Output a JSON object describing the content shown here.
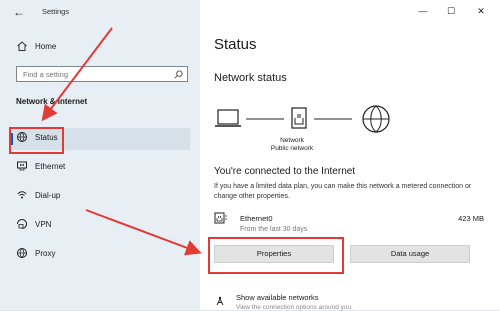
{
  "window": {
    "app_title": "Settings",
    "controls": {
      "minimize": "—",
      "maximize": "☐",
      "close": "✕"
    }
  },
  "nav": {
    "back_glyph": "←",
    "home_label": "Home",
    "search": {
      "placeholder": "Find a setting"
    },
    "section_heading": "Network & Internet",
    "items": [
      {
        "label": "Status",
        "icon": "globe-status-icon",
        "selected": true
      },
      {
        "label": "Ethernet",
        "icon": "ethernet-icon",
        "selected": false
      },
      {
        "label": "Dial-up",
        "icon": "dialup-icon",
        "selected": false
      },
      {
        "label": "VPN",
        "icon": "vpn-icon",
        "selected": false
      },
      {
        "label": "Proxy",
        "icon": "globe-icon",
        "selected": false
      }
    ]
  },
  "main": {
    "title": "Status",
    "subtitle": "Network status",
    "diagram": {
      "label_line1": "Network",
      "label_line2": "Public network"
    },
    "connected_text": "You're connected to the Internet",
    "description": "If you have a limited data plan, you can make this network a metered connection or change other properties.",
    "adapter": {
      "name": "Ethernet0",
      "subtext": "From the last 30 days",
      "usage": "423 MB"
    },
    "buttons": {
      "properties": "Properties",
      "data_usage": "Data usage"
    },
    "show_networks": {
      "label": "Show available networks",
      "subtext": "View the connection options around you."
    }
  },
  "annotations": {
    "highlight_color": "#e23b37"
  }
}
